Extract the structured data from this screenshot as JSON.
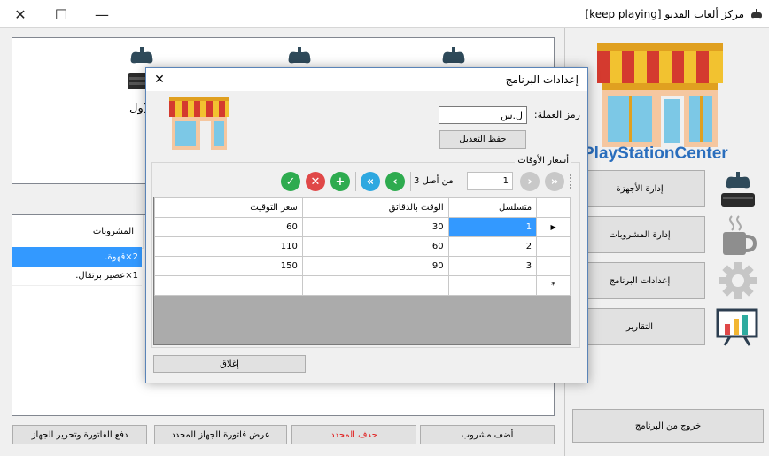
{
  "window": {
    "title": "مركز ألعاب الفديو [keep playing]",
    "min_glyph": "—",
    "max_glyph": "☐",
    "close_glyph": "✕"
  },
  "devices": {
    "partial_label": "ول)"
  },
  "drinks_list": {
    "header": "المشروبات",
    "rows": [
      "2×قهوة.",
      "1×عصير برتقال."
    ]
  },
  "bottom_buttons": {
    "add_drink": "أضف مشروب",
    "delete_selected": "حذف المحدد",
    "show_invoice": "عرض فاتورة الجهاز المحدد",
    "pay_invoice": "دفع الفاتورة وتحرير الجهاز"
  },
  "sidebar": {
    "brand": "PlayStationCenter",
    "items": [
      {
        "label": "إدارة الأجهزة",
        "icon": "gamepad-icon"
      },
      {
        "label": "إدارة المشروبات",
        "icon": "coffee-cup-icon"
      },
      {
        "label": "إعدادات البرنامج",
        "icon": "gear-icon"
      },
      {
        "label": "التقارير",
        "icon": "chart-board-icon"
      }
    ],
    "exit": "خروج من البرنامج"
  },
  "dialog": {
    "title": "إعدادات البرنامج",
    "close_glyph": "✕",
    "currency_label": "رمز العملة:",
    "currency_value": "ل.س",
    "save_label": "حفظ التعديل",
    "group_title": "أسعار الأوقات",
    "nav": {
      "position": "1",
      "of_total": "من أصل 3",
      "first_glyph": "«",
      "prev_glyph": "‹",
      "next_glyph": "›",
      "last_glyph": "»",
      "add_glyph": "+",
      "delete_glyph": "✕",
      "save_glyph": "✓"
    },
    "grid": {
      "columns": [
        "متسلسل",
        "الوقت بالدقائق",
        "سعر التوقيت"
      ],
      "rows": [
        [
          "1",
          "30",
          "60"
        ],
        [
          "2",
          "60",
          "110"
        ],
        [
          "3",
          "90",
          "150"
        ]
      ],
      "current_row_glyph": "▶",
      "new_row_glyph": "*"
    },
    "close_label": "إغلاق"
  },
  "colors": {
    "selection": "#3399ff",
    "brand": "#2a6ebd",
    "accent_green": "#2eab4f",
    "accent_red": "#e04848"
  }
}
